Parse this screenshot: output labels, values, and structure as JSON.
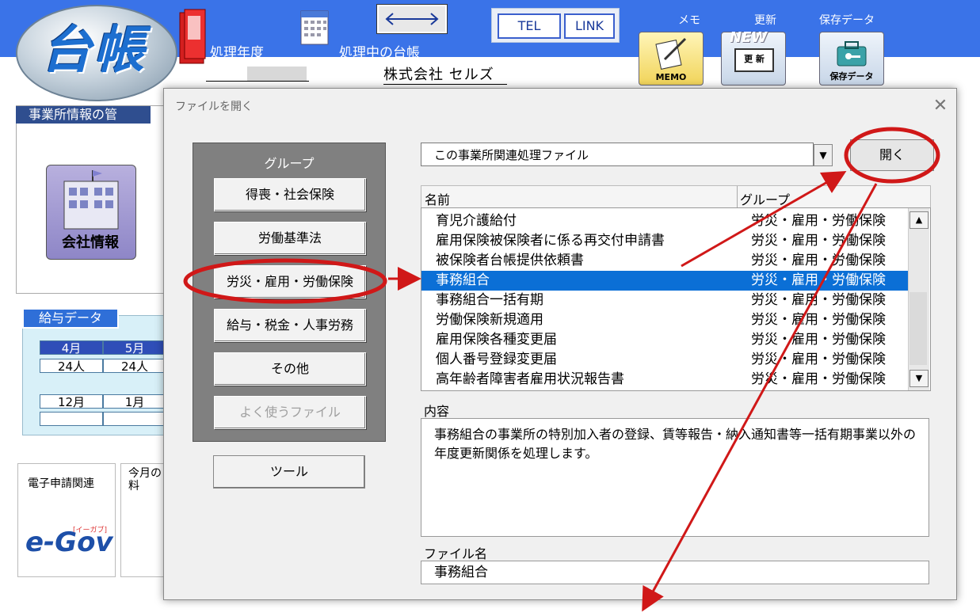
{
  "app": {
    "logo_text": "台帳",
    "year_label": "処理年度",
    "ledger_label": "処理中の台帳",
    "company_name": "株式会社 セルズ",
    "tel_label": "TEL",
    "link_label": "LINK",
    "memo_label": "メモ",
    "memo_caption": "MEMO",
    "update_label": "更新",
    "update_badge": "NEW",
    "update_caption": "更 新",
    "save_label": "保存データ",
    "save_caption": "保存データ",
    "colors": {
      "topbar": "#3a73e8",
      "selection": "#0b6fd6",
      "annotation": "#d01818"
    }
  },
  "background": {
    "office_title": "事業所情報の管",
    "company_info_label": "会社情報",
    "salary_title": "給与データ",
    "salary_months_row1": [
      "4月",
      "5月"
    ],
    "salary_values_row1": [
      "24人",
      "24人"
    ],
    "salary_months_row2": [
      "12月",
      "1月"
    ],
    "egov_title": "電子申請関連",
    "egov_logo": "e-Gov",
    "egov_sub": "[イーガブ]",
    "month_title": "今月の料"
  },
  "dialog": {
    "title": "ファイルを開く",
    "close_icon": "close-icon",
    "group_heading": "グループ",
    "groups": [
      {
        "label": "得喪・社会保険"
      },
      {
        "label": "労働基準法"
      },
      {
        "label": "労災・雇用・労働保険"
      },
      {
        "label": "給与・税金・人事労務"
      },
      {
        "label": "その他"
      },
      {
        "label": "よく使うファイル"
      }
    ],
    "tool_button": "ツール",
    "file_type": "この事業所関連処理ファイル",
    "open_button": "開く",
    "columns": {
      "name": "名前",
      "group": "グループ"
    },
    "files": [
      {
        "name": "育児介護給付",
        "group": "労災・雇用・労働保険"
      },
      {
        "name": "雇用保険被保険者に係る再交付申請書",
        "group": "労災・雇用・労働保険"
      },
      {
        "name": "被保険者台帳提供依頼書",
        "group": "労災・雇用・労働保険"
      },
      {
        "name": "事務組合",
        "group": "労災・雇用・労働保険"
      },
      {
        "name": "事務組合一括有期",
        "group": "労災・雇用・労働保険"
      },
      {
        "name": "労働保険新規適用",
        "group": "労災・雇用・労働保険"
      },
      {
        "name": "雇用保険各種変更届",
        "group": "労災・雇用・労働保険"
      },
      {
        "name": "個人番号登録変更届",
        "group": "労災・雇用・労働保険"
      },
      {
        "name": "高年齢者障害者雇用状況報告書",
        "group": "労災・雇用・労働保険"
      }
    ],
    "selected_file": "事務組合",
    "content_label": "内容",
    "content_text": "事務組合の事業所の特別加入者の登録、賃等報告・納入通知書等一括有期事業以外の年度更新関係を処理します。",
    "filename_label": "ファイル名",
    "filename_value": "事務組合"
  }
}
